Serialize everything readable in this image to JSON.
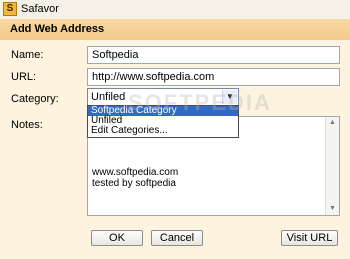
{
  "window": {
    "title": "Safavor",
    "app_icon": "safavor-app-icon"
  },
  "dialog": {
    "header": "Add Web Address"
  },
  "form": {
    "name_label": "Name:",
    "name_value": "Softpedia",
    "url_label": "URL:",
    "url_value": "http://www.softpedia.com",
    "category_label": "Category:",
    "category_value": "Unfiled",
    "category_options": [
      "Softpedia Category",
      "Unfiled",
      "Edit Categories..."
    ],
    "category_selected_option": "Softpedia Category",
    "notes_label": "Notes:",
    "notes_value": "www.softpedia.com\ntested by softpedia"
  },
  "buttons": {
    "ok": "OK",
    "cancel": "Cancel",
    "visit_url": "Visit URL"
  },
  "watermark": "SOFTPEDIA",
  "colors": {
    "selection": "#316ac5",
    "header_bg": "#f3c98b",
    "content_bg": "#fdf3df"
  }
}
